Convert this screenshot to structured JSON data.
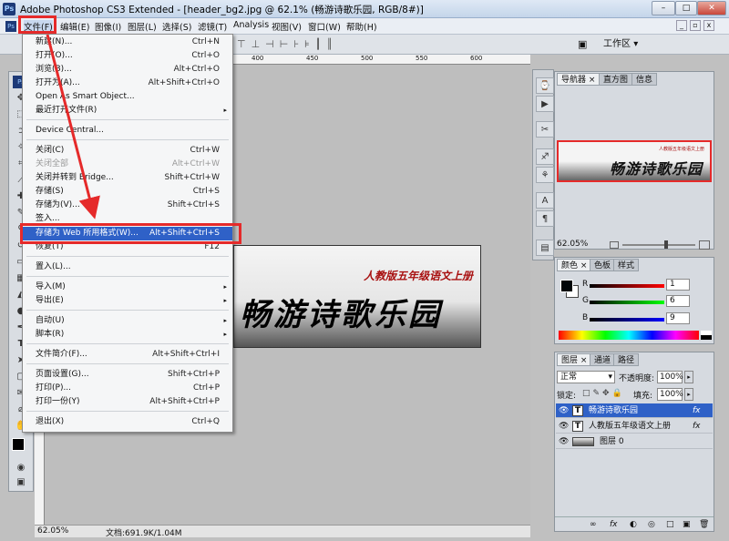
{
  "window": {
    "title": "Adobe Photoshop CS3 Extended - [header_bg2.jpg @ 62.1% (畅游诗歌乐园, RGB/8#)]",
    "minimize": "–",
    "maximize": "□",
    "close": "✕",
    "app_badge": "Ps",
    "doc_min": "_",
    "doc_restore": "▫",
    "doc_close": "x"
  },
  "menubar": [
    "文件(F)",
    "编辑(E)",
    "图像(I)",
    "图层(L)",
    "选择(S)",
    "滤镜(T)",
    "Analysis",
    "视图(V)",
    "窗口(W)",
    "帮助(H)"
  ],
  "options": {
    "workspace_label": "工作区",
    "workspace_arrow": "▾"
  },
  "file_menu": [
    {
      "label": "新建(N)...",
      "shortcut": "Ctrl+N"
    },
    {
      "label": "打开(O)...",
      "shortcut": "Ctrl+O"
    },
    {
      "label": "浏览(B)...",
      "shortcut": "Alt+Ctrl+O"
    },
    {
      "label": "打开为(A)...",
      "shortcut": "Alt+Shift+Ctrl+O"
    },
    {
      "label": "Open As Smart Object...",
      "shortcut": ""
    },
    {
      "label": "最近打开文件(R)",
      "shortcut": "",
      "submenu": "▸"
    },
    {
      "label": "Device Central...",
      "shortcut": ""
    },
    {
      "label": "关闭(C)",
      "shortcut": "Ctrl+W"
    },
    {
      "label": "关闭全部",
      "shortcut": "Alt+Ctrl+W"
    },
    {
      "label": "关闭并转到 Bridge...",
      "shortcut": "Shift+Ctrl+W"
    },
    {
      "label": "存储(S)",
      "shortcut": "Ctrl+S"
    },
    {
      "label": "存储为(V)...",
      "shortcut": "Shift+Ctrl+S"
    },
    {
      "label": "签入...",
      "shortcut": ""
    },
    {
      "label": "存储为 Web 所用格式(W)...",
      "shortcut": "Alt+Shift+Ctrl+S"
    },
    {
      "label": "恢复(T)",
      "shortcut": "F12"
    },
    {
      "label": "置入(L)...",
      "shortcut": ""
    },
    {
      "label": "导入(M)",
      "shortcut": "",
      "submenu": "▸"
    },
    {
      "label": "导出(E)",
      "shortcut": "",
      "submenu": "▸"
    },
    {
      "label": "自动(U)",
      "shortcut": "",
      "submenu": "▸"
    },
    {
      "label": "脚本(R)",
      "shortcut": "",
      "submenu": "▸"
    },
    {
      "label": "文件简介(F)...",
      "shortcut": "Alt+Shift+Ctrl+I"
    },
    {
      "label": "页面设置(G)...",
      "shortcut": "Shift+Ctrl+P"
    },
    {
      "label": "打印(P)...",
      "shortcut": "Ctrl+P"
    },
    {
      "label": "打印一份(Y)",
      "shortcut": "Alt+Shift+Ctrl+P"
    },
    {
      "label": "退出(X)",
      "shortcut": "Ctrl+Q"
    }
  ],
  "ruler": {
    "top_ticks": [
      "400",
      "450",
      "500",
      "550",
      "600"
    ]
  },
  "canvas": {
    "subtitle": "人教版五年级语文上册",
    "title": "畅游诗歌乐园"
  },
  "status": {
    "zoom": "62.05%",
    "doc_info": "文档:691.9K/1.04M"
  },
  "navigator": {
    "tabs": [
      "导航器",
      "直方图",
      "信息"
    ],
    "zoom": "62.05%"
  },
  "color_panel": {
    "tabs": [
      "颜色",
      "色板",
      "样式"
    ],
    "channels": [
      {
        "label": "R",
        "value": "1"
      },
      {
        "label": "G",
        "value": "6"
      },
      {
        "label": "B",
        "value": "9"
      }
    ]
  },
  "layers_panel": {
    "tabs": [
      "图层",
      "通道",
      "路径"
    ],
    "blend_mode": "正常",
    "opacity_label": "不透明度:",
    "opacity": "100%",
    "lock_label": "锁定:",
    "fill_label": "填充:",
    "fill": "100%",
    "layers": [
      {
        "name": "畅游诗歌乐园",
        "type": "T",
        "fx": "fx"
      },
      {
        "name": "人教版五年级语文上册",
        "type": "T",
        "fx": "fx"
      },
      {
        "name": "图层 0",
        "type": "",
        "fx": ""
      }
    ],
    "footer_icons": [
      "∞",
      "fx",
      "◐",
      "◎",
      "□",
      "▣",
      "🗑"
    ]
  },
  "colors": {
    "highlight": "#2f61c7",
    "annotation": "#e52a2a"
  }
}
